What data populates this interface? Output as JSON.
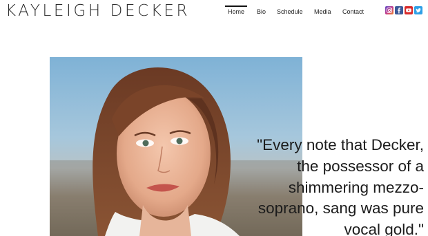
{
  "brand": {
    "name": "KAYLEIGH DECKER"
  },
  "nav": {
    "items": [
      {
        "label": "Home",
        "active": true
      },
      {
        "label": "Bio"
      },
      {
        "label": "Schedule"
      },
      {
        "label": "Media"
      },
      {
        "label": "Contact"
      }
    ]
  },
  "social": {
    "icons": [
      {
        "icon": "instagram-icon",
        "color": "#c43a8c"
      },
      {
        "icon": "facebook-icon",
        "color": "#3b5998"
      },
      {
        "icon": "youtube-icon",
        "color": "#d82a2a"
      },
      {
        "icon": "twitter-icon",
        "color": "#2ea0e6"
      }
    ]
  },
  "hero": {
    "quote_lines": [
      "\"Every note that Decker,",
      "the possessor of a",
      "shimmering mezzo-",
      "soprano, sang was pure",
      "vocal gold.\""
    ]
  }
}
